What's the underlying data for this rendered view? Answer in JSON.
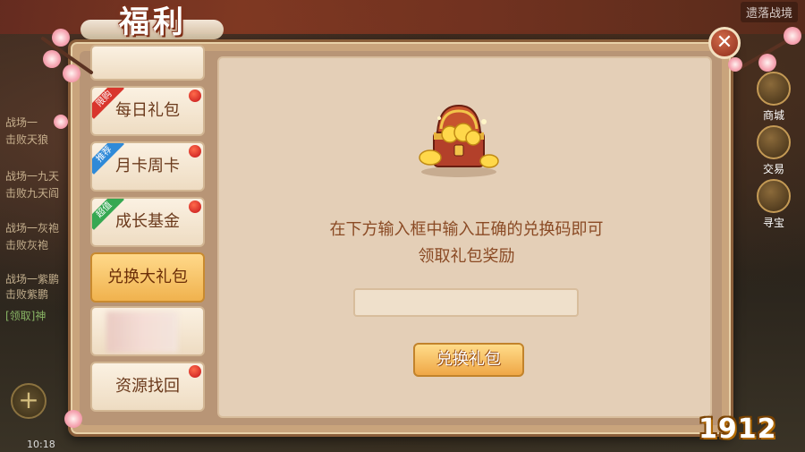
{
  "scene": {
    "top_right_label": "遗落战境",
    "chat": [
      {
        "text": "战场一",
        "style": "normal"
      },
      {
        "text": "击败天狼",
        "style": "normal"
      },
      {
        "text": "战场一九天",
        "style": "normal"
      },
      {
        "text": "击败九天阎",
        "style": "normal"
      },
      {
        "text": "战场一灰袍",
        "style": "normal"
      },
      {
        "text": "击败灰袍",
        "style": "normal"
      },
      {
        "text": "战场一紫鹏",
        "style": "normal"
      },
      {
        "text": "击败紫鹏",
        "style": "normal"
      },
      {
        "text": "[领取]神",
        "style": "green"
      }
    ],
    "side_buttons": [
      {
        "label": "商城"
      },
      {
        "label": "交易"
      },
      {
        "label": "寻宝"
      }
    ],
    "time": "10:18"
  },
  "panel": {
    "title": "福利",
    "tabs": [
      {
        "label": "每日礼包",
        "ribbon": "限购",
        "ribbon_color": "red",
        "dot": true
      },
      {
        "label": "月卡周卡",
        "ribbon": "推荐",
        "ribbon_color": "blue",
        "dot": true
      },
      {
        "label": "成长基金",
        "ribbon": "超值",
        "ribbon_color": "green",
        "dot": true
      },
      {
        "label": "兑换大礼包",
        "ribbon": "",
        "ribbon_color": "",
        "dot": false,
        "active": true
      },
      {
        "label": "",
        "ribbon": "",
        "ribbon_color": "",
        "dot": false,
        "blurred": true
      },
      {
        "label": "资源找回",
        "ribbon": "",
        "ribbon_color": "",
        "dot": true
      }
    ],
    "content": {
      "instruction_line1": "在下方输入框中输入正确的兑换码即可",
      "instruction_line2": "领取礼包奖励",
      "input_value": "",
      "input_placeholder": "",
      "redeem_button": "兑换礼包"
    }
  },
  "watermark": "1912",
  "colors": {
    "panel_bg": "#c9a47c",
    "content_bg": "#e4cfb7",
    "tab_active": "#f0b24e",
    "text_brown": "#8a4a24"
  }
}
